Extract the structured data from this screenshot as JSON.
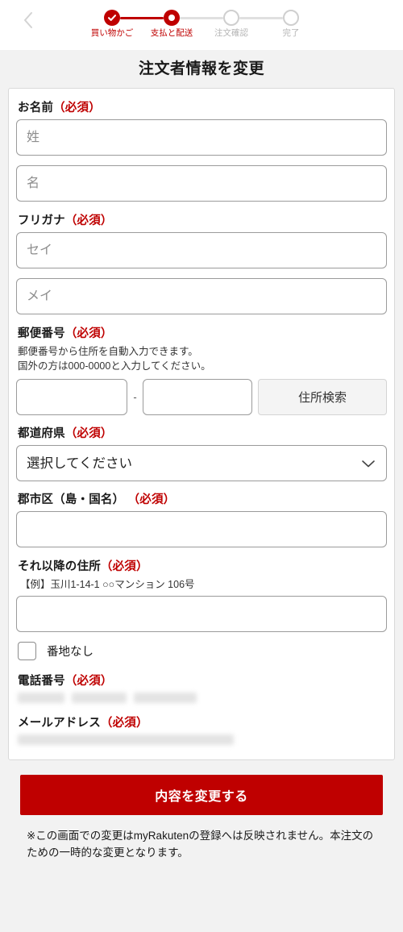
{
  "header": {
    "back_icon": "chevron-left-icon",
    "steps": [
      {
        "label": "買い物かご",
        "state": "done"
      },
      {
        "label": "支払と配送",
        "state": "current"
      },
      {
        "label": "注文確認",
        "state": "todo"
      },
      {
        "label": "完了",
        "state": "todo"
      }
    ]
  },
  "page_title": "注文者情報を変更",
  "required_mark": "（必須）",
  "form": {
    "name": {
      "label": "お名前",
      "last_placeholder": "姓",
      "first_placeholder": "名",
      "last_value": "",
      "first_value": ""
    },
    "furigana": {
      "label": "フリガナ",
      "last_placeholder": "セイ",
      "first_placeholder": "メイ",
      "last_value": "",
      "first_value": ""
    },
    "postal": {
      "label": "郵便番号",
      "help_line1": "郵便番号から住所を自動入力できます。",
      "help_line2": "国外の方は000-0000と入力してください。",
      "part1_value": "",
      "part2_value": "",
      "separator": "-",
      "search_button": "住所検索"
    },
    "prefecture": {
      "label": "都道府県",
      "selected": "選択してください",
      "options": [
        "選択してください"
      ]
    },
    "city": {
      "label": "郡市区（島・国名）",
      "value": ""
    },
    "address_rest": {
      "label": "それ以降の住所",
      "example": "【例】玉川1-14-1 ○○マンション 106号",
      "value": ""
    },
    "no_banchi": {
      "label": "番地なし",
      "checked": false
    },
    "phone": {
      "label": "電話番号",
      "value": "",
      "redacted": true
    },
    "email": {
      "label": "メールアドレス",
      "value": "",
      "redacted": true
    }
  },
  "submit_button": "内容を変更する",
  "footnote": "※この画面での変更はmyRakutenの登録へは反映されません。本注文のための一時的な変更となります。",
  "colors": {
    "brand_red": "#bf0000",
    "page_bg": "#f2f2f2",
    "card_bg": "#ffffff",
    "inactive_gray": "#cfcfcf"
  }
}
